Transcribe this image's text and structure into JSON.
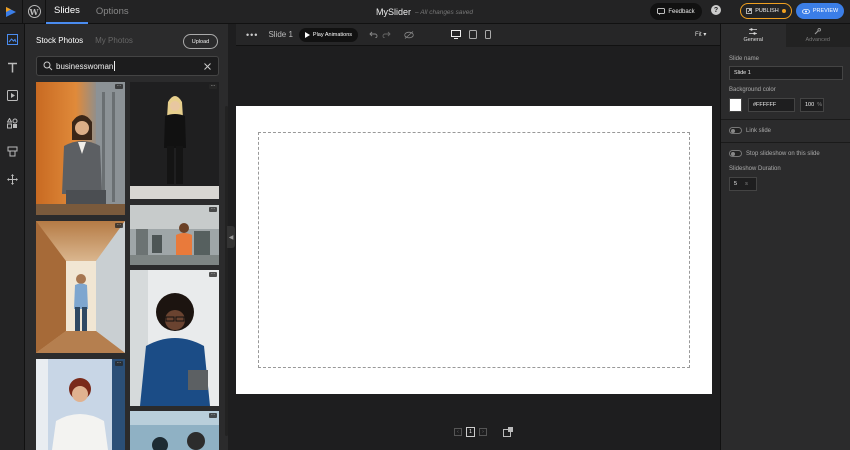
{
  "topbar": {
    "tabs": [
      "Slides",
      "Options"
    ],
    "app_name": "MySlider",
    "save_status": "– All changes saved",
    "feedback_label": "Feedback",
    "help_label": "?",
    "publish_label": "PUBLISH",
    "preview_label": "PREVIEW"
  },
  "left_panel": {
    "tabs": [
      "Stock Photos",
      "My Photos"
    ],
    "upload_label": "Upload",
    "search": {
      "value": "businesswoman"
    },
    "more_label": "···"
  },
  "toolbar": {
    "slide_label": "Slide 1",
    "play_label": "Play Animations",
    "fit_label": "Fit"
  },
  "pager": {
    "current": "1"
  },
  "right_panel": {
    "tabs": [
      "General",
      "Advanced"
    ],
    "slide_name_label": "Slide name",
    "slide_name_value": "Slide 1",
    "bg_color_label": "Background color",
    "bg_color_value": "#FFFFFF",
    "opacity_value": "100",
    "opacity_unit": "%",
    "link_slide_label": "Link slide",
    "stop_slideshow_label": "Stop slideshow on this slide",
    "duration_label": "Slideshow Duration",
    "duration_value": "5",
    "duration_unit": "s"
  },
  "colors": {
    "accent": "#3b7ee8",
    "publish": "#f0a020",
    "panel": "#2b2b2c",
    "background": "#1e1e1f"
  }
}
